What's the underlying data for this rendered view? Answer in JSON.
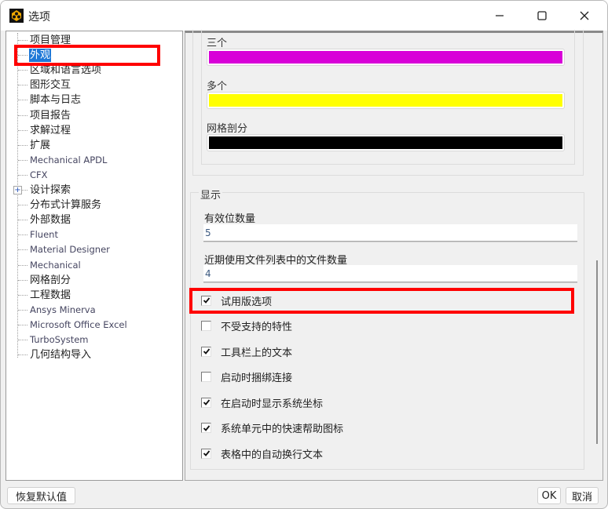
{
  "window": {
    "title": "选项",
    "controls": {
      "minimize": "minimize",
      "maximize": "maximize",
      "close": "close"
    }
  },
  "tree": {
    "items": [
      {
        "label": "项目管理",
        "latin": false,
        "selected": false,
        "expandable": false
      },
      {
        "label": "外观",
        "latin": false,
        "selected": true,
        "expandable": false
      },
      {
        "label": "区域和语言选项",
        "latin": false,
        "selected": false,
        "expandable": false
      },
      {
        "label": "图形交互",
        "latin": false,
        "selected": false,
        "expandable": false
      },
      {
        "label": "脚本与日志",
        "latin": false,
        "selected": false,
        "expandable": false
      },
      {
        "label": "项目报告",
        "latin": false,
        "selected": false,
        "expandable": false
      },
      {
        "label": "求解过程",
        "latin": false,
        "selected": false,
        "expandable": false
      },
      {
        "label": "扩展",
        "latin": false,
        "selected": false,
        "expandable": false
      },
      {
        "label": "Mechanical APDL",
        "latin": true,
        "selected": false,
        "expandable": false
      },
      {
        "label": "CFX",
        "latin": true,
        "selected": false,
        "expandable": false
      },
      {
        "label": "设计探索",
        "latin": false,
        "selected": false,
        "expandable": true
      },
      {
        "label": "分布式计算服务",
        "latin": false,
        "selected": false,
        "expandable": false
      },
      {
        "label": "外部数据",
        "latin": false,
        "selected": false,
        "expandable": false
      },
      {
        "label": "Fluent",
        "latin": true,
        "selected": false,
        "expandable": false
      },
      {
        "label": "Material Designer",
        "latin": true,
        "selected": false,
        "expandable": false
      },
      {
        "label": "Mechanical",
        "latin": true,
        "selected": false,
        "expandable": false
      },
      {
        "label": "网格剖分",
        "latin": false,
        "selected": false,
        "expandable": false
      },
      {
        "label": "工程数据",
        "latin": false,
        "selected": false,
        "expandable": false
      },
      {
        "label": "Ansys Minerva",
        "latin": true,
        "selected": false,
        "expandable": false
      },
      {
        "label": "Microsoft Office Excel",
        "latin": true,
        "selected": false,
        "expandable": false
      },
      {
        "label": "TurboSystem",
        "latin": true,
        "selected": false,
        "expandable": false
      },
      {
        "label": "几何结构导入",
        "latin": false,
        "selected": false,
        "expandable": false
      }
    ]
  },
  "colors": [
    {
      "label": "三个",
      "color": "#d800d8"
    },
    {
      "label": "多个",
      "color": "#ffff00"
    },
    {
      "label": "网格剖分",
      "color": "#000000"
    }
  ],
  "display": {
    "group_title": "显示",
    "significant_digits": {
      "label": "有效位数量",
      "value": "5"
    },
    "recent_files": {
      "label": "近期使用文件列表中的文件数量",
      "value": "4"
    },
    "checkboxes": [
      {
        "label": "试用版选项",
        "checked": true
      },
      {
        "label": "不受支持的特性",
        "checked": false
      },
      {
        "label": "工具栏上的文本",
        "checked": true
      },
      {
        "label": "启动时捆绑连接",
        "checked": false
      },
      {
        "label": "在启动时显示系统坐标",
        "checked": true
      },
      {
        "label": "系统单元中的快速帮助图标",
        "checked": true
      },
      {
        "label": "表格中的自动换行文本",
        "checked": true
      }
    ]
  },
  "buttons": {
    "restore_defaults": "恢复默认值",
    "ok": "OK",
    "cancel": "取消"
  },
  "annotations": {
    "highlight_color": "#ff0000",
    "highlighted": [
      "外观",
      "试用版选项"
    ]
  }
}
